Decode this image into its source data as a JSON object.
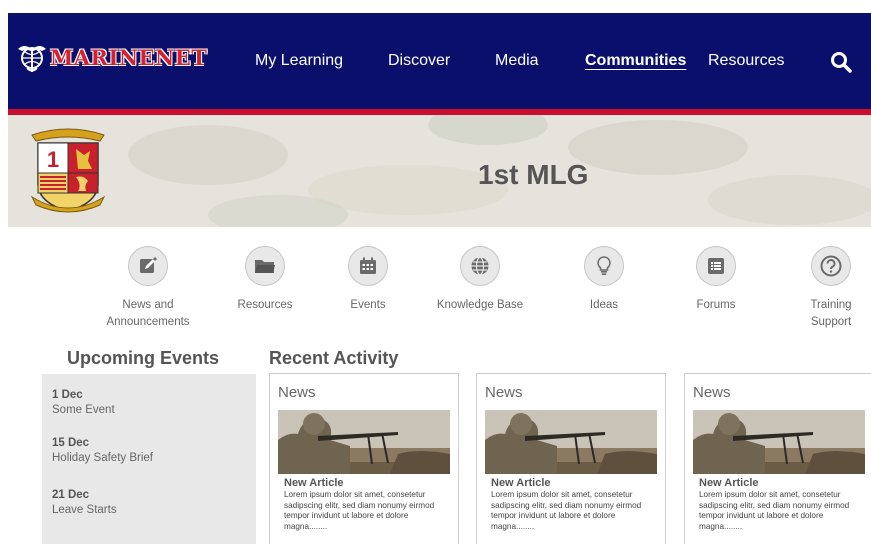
{
  "brand": {
    "name": "MARINENET",
    "accent": "#0a0f6c",
    "stripe": "#c8102e"
  },
  "nav": {
    "items": [
      {
        "label": "My Learning",
        "active": false
      },
      {
        "label": "Discover",
        "active": false
      },
      {
        "label": "Media",
        "active": false
      },
      {
        "label": "Communities",
        "active": true
      },
      {
        "label": "Resources",
        "active": false
      }
    ],
    "search_icon": "search-icon"
  },
  "banner": {
    "title": "1st MLG",
    "crest_number": "1"
  },
  "tiles": [
    {
      "label": "News and Announcements",
      "icon": "edit-icon"
    },
    {
      "label": "Resources",
      "icon": "folder-icon"
    },
    {
      "label": "Events",
      "icon": "calendar-icon"
    },
    {
      "label": "Knowledge Base",
      "icon": "globe-icon"
    },
    {
      "label": "Ideas",
      "icon": "lightbulb-icon"
    },
    {
      "label": "Forums",
      "icon": "list-icon"
    },
    {
      "label": "Training Support",
      "icon": "question-icon"
    }
  ],
  "upcoming": {
    "title": "Upcoming Events",
    "events": [
      {
        "date": "1 Dec",
        "name": "Some Event"
      },
      {
        "date": "15 Dec",
        "name": "Holiday Safety Brief"
      },
      {
        "date": "21 Dec",
        "name": "Leave Starts"
      }
    ]
  },
  "recent": {
    "title": "Recent Activity",
    "cards": [
      {
        "kind": "News",
        "title": "New Article",
        "text": "Lorem ipsum dolor sit amet, consetetur sadipscing elitr, sed diam nonumy eirmod tempor invidunt ut labore et dolore magna........"
      },
      {
        "kind": "News",
        "title": "New Article",
        "text": "Lorem ipsum dolor sit amet, consetetur sadipscing elitr, sed diam nonumy eirmod tempor invidunt ut labore et dolore magna........"
      },
      {
        "kind": "News",
        "title": "New Article",
        "text": "Lorem ipsum dolor sit amet, consetetur sadipscing elitr, sed diam nonumy eirmod tempor invidunt ut labore et dolore magna........"
      }
    ]
  }
}
